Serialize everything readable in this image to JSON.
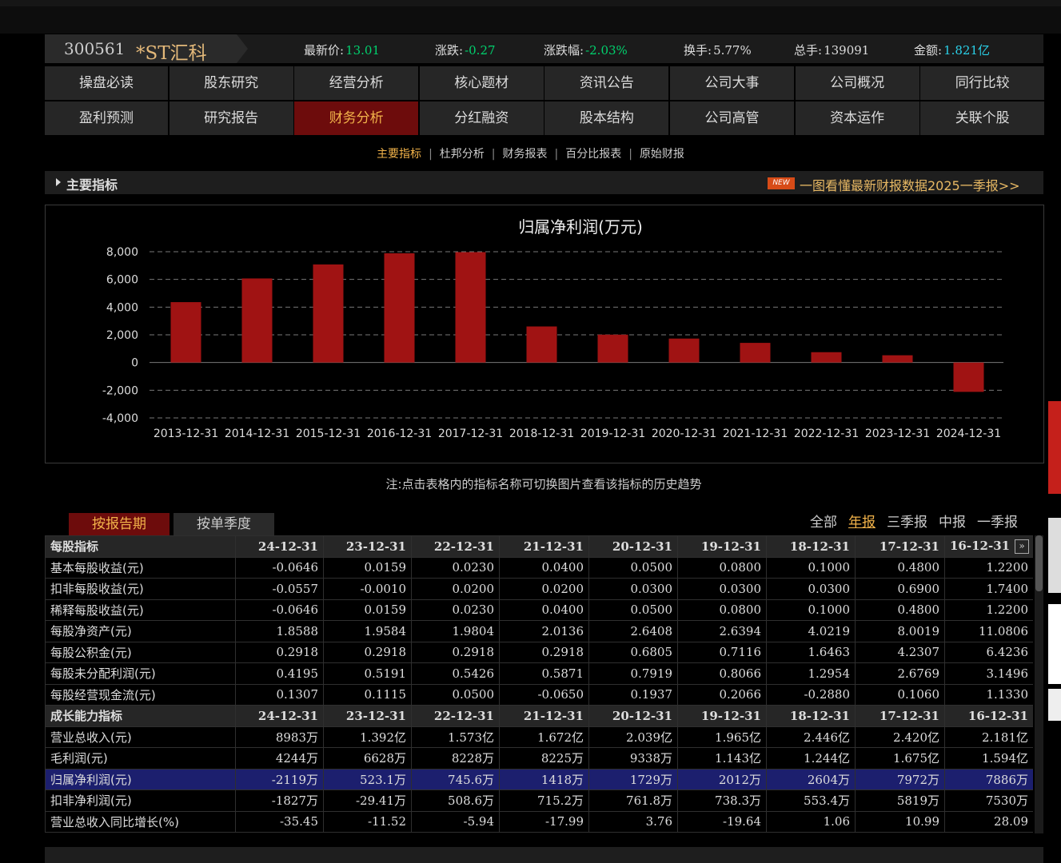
{
  "stock": {
    "code": "300561",
    "name": "*ST汇科",
    "quotes": [
      {
        "label": "最新价:",
        "value": "13.01",
        "color": "green"
      },
      {
        "label": "涨跌:",
        "value": "-0.27",
        "color": "green"
      },
      {
        "label": "涨跌幅:",
        "value": "-2.03%",
        "color": "green"
      },
      {
        "label": "换手:",
        "value": "5.77%",
        "color": "white"
      },
      {
        "label": "总手:",
        "value": "139091",
        "color": "white"
      },
      {
        "label": "金额:",
        "value": "1.821亿",
        "color": "cyan"
      }
    ]
  },
  "nav_row1": [
    "操盘必读",
    "股东研究",
    "经营分析",
    "核心题材",
    "资讯公告",
    "公司大事",
    "公司概况",
    "同行比较"
  ],
  "nav_row2": [
    "盈利预测",
    "研究报告",
    "财务分析",
    "分红融资",
    "股本结构",
    "公司高管",
    "资本运作",
    "关联个股"
  ],
  "nav_active": "财务分析",
  "subnav": [
    "主要指标",
    "杜邦分析",
    "财务报表",
    "百分比报表",
    "原始财报"
  ],
  "subnav_active": "主要指标",
  "section": {
    "title": "主要指标",
    "badge": "NEW",
    "link": "一图看懂最新财报数据2025一季报>>"
  },
  "chart_data": {
    "type": "bar",
    "title": "归属净利润(万元)",
    "categories": [
      "2013-12-31",
      "2014-12-31",
      "2015-12-31",
      "2016-12-31",
      "2017-12-31",
      "2018-12-31",
      "2019-12-31",
      "2020-12-31",
      "2021-12-31",
      "2022-12-31",
      "2023-12-31",
      "2024-12-31"
    ],
    "values": [
      4360,
      6070,
      7080,
      7886,
      7972,
      2604,
      2012,
      1729,
      1418,
      745.6,
      523.1,
      -2119
    ],
    "ylim": [
      -4000,
      8000
    ],
    "yticks": [
      -4000,
      -2000,
      0,
      2000,
      4000,
      6000,
      8000
    ],
    "ytick_labels": [
      "-4,000",
      "-2,000",
      "0",
      "2,000",
      "4,000",
      "6,000",
      "8,000"
    ],
    "bar_color": "#a01313",
    "grid": true,
    "xlabel": "",
    "ylabel": ""
  },
  "note": "注:点击表格内的指标名称可切换图片查看该指标的历史趋势",
  "tabs": [
    "按报告期",
    "按单季度"
  ],
  "filters": [
    "全部",
    "年报",
    "三季报",
    "中报",
    "一季报"
  ],
  "filter_active": "年报",
  "table": {
    "periods": [
      "24-12-31",
      "23-12-31",
      "22-12-31",
      "21-12-31",
      "20-12-31",
      "19-12-31",
      "18-12-31",
      "17-12-31",
      "16-12-31"
    ],
    "scroll_glyph": "»",
    "groups": [
      {
        "title": "每股指标",
        "rows": [
          {
            "name": "基本每股收益(元)",
            "values": [
              "-0.0646",
              "0.0159",
              "0.0230",
              "0.0400",
              "0.0500",
              "0.0800",
              "0.1000",
              "0.4800",
              "1.2200"
            ]
          },
          {
            "name": "扣非每股收益(元)",
            "values": [
              "-0.0557",
              "-0.0010",
              "0.0200",
              "0.0200",
              "0.0300",
              "0.0300",
              "0.0300",
              "0.6900",
              "1.7400"
            ]
          },
          {
            "name": "稀释每股收益(元)",
            "values": [
              "-0.0646",
              "0.0159",
              "0.0230",
              "0.0400",
              "0.0500",
              "0.0800",
              "0.1000",
              "0.4800",
              "1.2200"
            ]
          },
          {
            "name": "每股净资产(元)",
            "values": [
              "1.8588",
              "1.9584",
              "1.9804",
              "2.0136",
              "2.6408",
              "2.6394",
              "4.0219",
              "8.0019",
              "11.0806"
            ]
          },
          {
            "name": "每股公积金(元)",
            "values": [
              "0.2918",
              "0.2918",
              "0.2918",
              "0.2918",
              "0.6805",
              "0.7116",
              "1.6463",
              "4.2307",
              "6.4236"
            ]
          },
          {
            "name": "每股未分配利润(元)",
            "values": [
              "0.4195",
              "0.5191",
              "0.5426",
              "0.5871",
              "0.7919",
              "0.8066",
              "1.2954",
              "2.6769",
              "3.1496"
            ]
          },
          {
            "name": "每股经营现金流(元)",
            "values": [
              "0.1307",
              "0.1115",
              "0.0500",
              "-0.0650",
              "0.1937",
              "0.2066",
              "-0.2880",
              "0.1060",
              "1.1330"
            ]
          }
        ]
      },
      {
        "title": "成长能力指标",
        "rows": [
          {
            "name": "营业总收入(元)",
            "values": [
              "8983万",
              "1.392亿",
              "1.573亿",
              "1.672亿",
              "2.039亿",
              "1.965亿",
              "2.446亿",
              "2.420亿",
              "2.181亿"
            ]
          },
          {
            "name": "毛利润(元)",
            "values": [
              "4244万",
              "6628万",
              "8228万",
              "8225万",
              "9338万",
              "1.143亿",
              "1.244亿",
              "1.675亿",
              "1.594亿"
            ]
          },
          {
            "name": "归属净利润(元)",
            "values": [
              "-2119万",
              "523.1万",
              "745.6万",
              "1418万",
              "1729万",
              "2012万",
              "2604万",
              "7972万",
              "7886万"
            ],
            "selected": true
          },
          {
            "name": "扣非净利润(元)",
            "values": [
              "-1827万",
              "-29.41万",
              "508.6万",
              "715.2万",
              "761.8万",
              "738.3万",
              "553.4万",
              "5819万",
              "7530万"
            ]
          },
          {
            "name": "营业总收入同比增长(%)",
            "values": [
              "-35.45",
              "-11.52",
              "-5.94",
              "-17.99",
              "3.76",
              "-19.64",
              "1.06",
              "10.99",
              "28.09"
            ]
          }
        ]
      }
    ]
  }
}
